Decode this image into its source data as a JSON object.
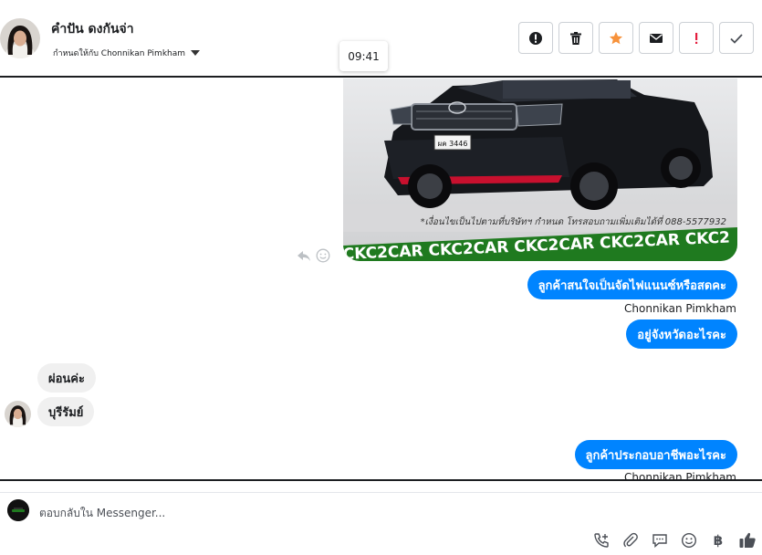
{
  "header": {
    "contact_name": "คำปัน ดงกันจ่า",
    "assign_label": "กำหนดให้กับ Chonnikan Pimkham",
    "tooltip_time": "09:41",
    "actions": [
      {
        "name": "report-spam-button",
        "icon": "exclamation-circle-icon"
      },
      {
        "name": "delete-button",
        "icon": "trash-icon"
      },
      {
        "name": "star-button",
        "icon": "star-icon",
        "color": "#f7923b"
      },
      {
        "name": "mark-unread-button",
        "icon": "envelope-icon"
      },
      {
        "name": "follow-up-button",
        "icon": "exclamation-icon",
        "color": "#e41e3f"
      },
      {
        "name": "mark-done-button",
        "icon": "checkmark-icon"
      }
    ]
  },
  "conversation": {
    "image": {
      "banner_text": "CKC2CAR CKC2CAR CKC2CAR CKC2CAR CKC2",
      "caption": "*เงื่อนไขเป็นไปตามที่บริษัทฯ กำหนด โทรสอบถามเพิ่มเติมได้ที่ 088-5577932",
      "plate": "ผค 3446"
    },
    "messages": [
      {
        "direction": "out",
        "text": "ลูกค้าสนใจเป็นจัดไฟแนนซ์หรือสดคะ"
      },
      {
        "sender": "Chonnikan Pimkham"
      },
      {
        "direction": "out",
        "text": "อยู่จังหวัดอะไรคะ"
      },
      {
        "direction": "in",
        "text": "ผ่อนค่ะ"
      },
      {
        "direction": "in",
        "text": "บุรีรัมย์"
      },
      {
        "direction": "out",
        "text": "ลูกค้าประกอบอาชีพอะไรคะ"
      },
      {
        "sender": "Chonnikan Pimkham"
      }
    ]
  },
  "composer": {
    "placeholder": "ตอบกลับใน Messenger...",
    "tools": [
      "phone-add-icon",
      "paperclip-icon",
      "saved-reply-icon",
      "emoji-icon",
      "baht-icon",
      "thumbs-up-icon"
    ],
    "baht_symbol": "฿"
  },
  "colors": {
    "messenger_blue": "#0084ff",
    "incoming_bubble": "#f0f0f0",
    "banner_green": "#1f7a1f"
  }
}
